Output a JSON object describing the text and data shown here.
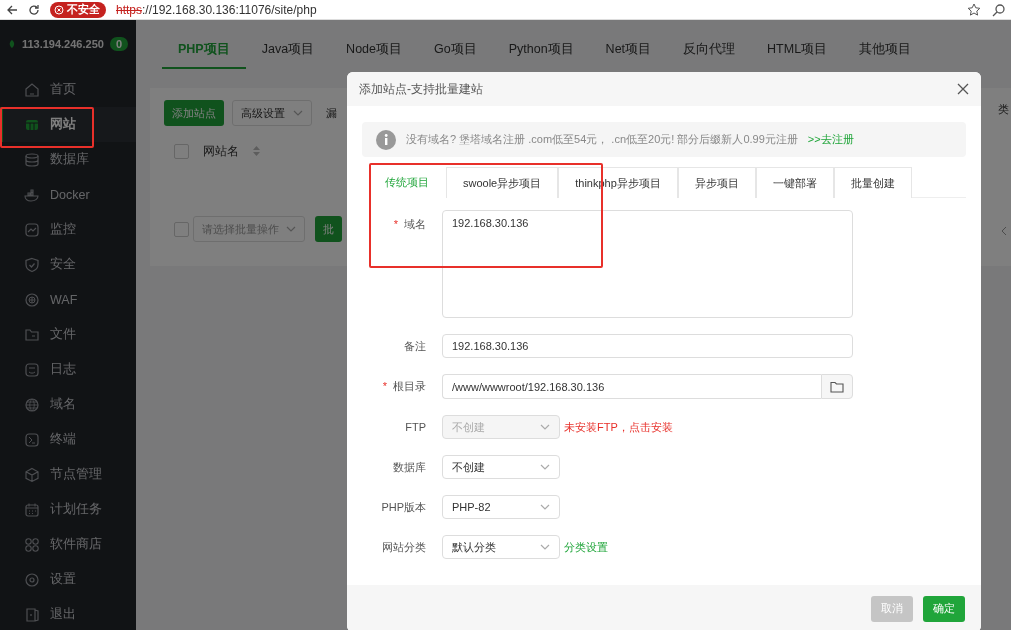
{
  "browser": {
    "security_badge": "不安全",
    "url_scheme": "https",
    "url_rest": "://192.168.30.136:11076/site/php"
  },
  "sidebar": {
    "server": "113.194.246.250",
    "count": "0",
    "items": [
      {
        "label": "首页",
        "selected": false
      },
      {
        "label": "网站",
        "selected": true
      },
      {
        "label": "数据库",
        "selected": false
      },
      {
        "label": "Docker",
        "selected": false
      },
      {
        "label": "监控",
        "selected": false
      },
      {
        "label": "安全",
        "selected": false
      },
      {
        "label": "WAF",
        "selected": false
      },
      {
        "label": "文件",
        "selected": false
      },
      {
        "label": "日志",
        "selected": false
      },
      {
        "label": "域名",
        "selected": false
      },
      {
        "label": "终端",
        "selected": false
      },
      {
        "label": "节点管理",
        "selected": false
      },
      {
        "label": "计划任务",
        "selected": false
      },
      {
        "label": "软件商店",
        "selected": false
      },
      {
        "label": "设置",
        "selected": false
      },
      {
        "label": "退出",
        "selected": false
      }
    ]
  },
  "main": {
    "tabs": [
      {
        "label": "PHP项目",
        "selected": true
      },
      {
        "label": "Java项目",
        "selected": false
      },
      {
        "label": "Node项目",
        "selected": false
      },
      {
        "label": "Go项目",
        "selected": false
      },
      {
        "label": "Python项目",
        "selected": false
      },
      {
        "label": "Net项目",
        "selected": false
      },
      {
        "label": "反向代理",
        "selected": false
      },
      {
        "label": "HTML项目",
        "selected": false
      },
      {
        "label": "其他项目",
        "selected": false
      }
    ],
    "add_button": "添加站点",
    "advanced_select": "高级设置",
    "cut_button": "漏",
    "right_cut_text": "类",
    "header_checkbox": {
      "checked": false
    },
    "table_column": "网站名",
    "batch_checkbox": {
      "checked": false
    },
    "batch_select": "请选择批量操作",
    "batch_button": "批"
  },
  "modal": {
    "title": "添加站点-支持批量建站",
    "notice": {
      "text": "没有域名? 堡塔域名注册 .com低至54元， .cn低至20元! 部分后缀新人0.99元注册",
      "link": ">>去注册"
    },
    "tabs": [
      {
        "label": "传统项目",
        "selected": true
      },
      {
        "label": "swoole异步项目",
        "selected": false
      },
      {
        "label": "thinkphp异步项目",
        "selected": false
      },
      {
        "label": "异步项目",
        "selected": false
      },
      {
        "label": "一键部署",
        "selected": false
      },
      {
        "label": "批量创建",
        "selected": false
      }
    ],
    "fields": [
      {
        "kind": "textarea",
        "label": "域名",
        "required_mark": "*",
        "value": "192.168.30.136"
      },
      {
        "kind": "input",
        "label": "备注",
        "value": "192.168.30.136"
      },
      {
        "kind": "path",
        "label": "根目录",
        "required_mark": "*",
        "value": "/www/wwwroot/192.168.30.136"
      },
      {
        "kind": "select",
        "label": "FTP",
        "value": "不创建",
        "disabled": true,
        "note": {
          "kind": "error",
          "text": "未安装FTP，点击安装"
        }
      },
      {
        "kind": "select",
        "label": "数据库",
        "value": "不创建",
        "disabled": false
      },
      {
        "kind": "select",
        "label": "PHP版本",
        "value": "PHP-82",
        "disabled": false
      },
      {
        "kind": "select",
        "label": "网站分类",
        "value": "默认分类",
        "disabled": false,
        "note": {
          "kind": "link",
          "text": "分类设置"
        }
      }
    ],
    "buttons": [
      {
        "label": "取消",
        "kind": "secondary"
      },
      {
        "label": "确定",
        "kind": "primary"
      }
    ]
  },
  "annotations": [
    {
      "kind": "red-box"
    },
    {
      "kind": "red-box"
    }
  ]
}
